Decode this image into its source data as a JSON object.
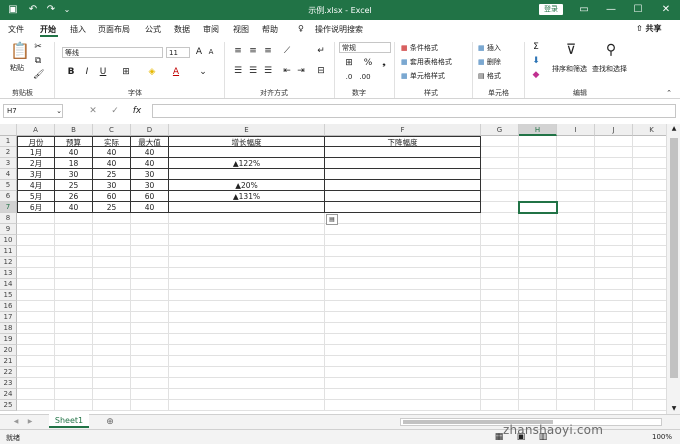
{
  "window": {
    "title": "示例.xlsx  -  Excel",
    "login_label": "登录"
  },
  "tabs": [
    "文件",
    "开始",
    "插入",
    "页面布局",
    "公式",
    "数据",
    "审阅",
    "视图",
    "帮助"
  ],
  "tell_me": "操作说明搜索",
  "share_label": "共享",
  "ribbon": {
    "paste": "粘贴",
    "font_name": "等线",
    "font_size": "11",
    "number_format": "常规",
    "cond_format": "条件格式",
    "table_format": "套用表格格式",
    "cell_style": "单元格样式",
    "insert": "插入",
    "delete": "删除",
    "format": "格式",
    "sort_filter": "排序和筛选",
    "find_select": "查找和选择",
    "groups": [
      "剪贴板",
      "字体",
      "对齐方式",
      "数字",
      "样式",
      "单元格",
      "编辑"
    ]
  },
  "formula_bar": {
    "name_box": "H7",
    "fx": "fx",
    "cancel": "✕",
    "enter": "✓"
  },
  "grid": {
    "columns": [
      "A",
      "B",
      "C",
      "D",
      "E",
      "F",
      "G",
      "H",
      "I",
      "J",
      "K"
    ],
    "rows": [
      "1",
      "2",
      "3",
      "4",
      "5",
      "6",
      "7",
      "8",
      "9",
      "10",
      "11",
      "12",
      "13",
      "14",
      "15",
      "16",
      "17",
      "18",
      "19",
      "20",
      "21",
      "22",
      "23",
      "24",
      "25"
    ],
    "header_row": [
      "月份",
      "预算",
      "实际",
      "最大值",
      "增长幅度",
      "下降幅度"
    ],
    "data": [
      [
        "1月",
        "40",
        "40",
        "40",
        "",
        ""
      ],
      [
        "2月",
        "18",
        "40",
        "40",
        "▲122%",
        ""
      ],
      [
        "3月",
        "30",
        "25",
        "30",
        "",
        ""
      ],
      [
        "4月",
        "25",
        "30",
        "30",
        "▲20%",
        ""
      ],
      [
        "5月",
        "26",
        "60",
        "60",
        "▲131%",
        ""
      ],
      [
        "6月",
        "40",
        "25",
        "40",
        "",
        ""
      ]
    ]
  },
  "sheet_tab": "Sheet1",
  "add_sheet": "⊕",
  "status": {
    "ready": "就绪",
    "zoom": "100%"
  },
  "watermark": "zhanshaoyi.com"
}
